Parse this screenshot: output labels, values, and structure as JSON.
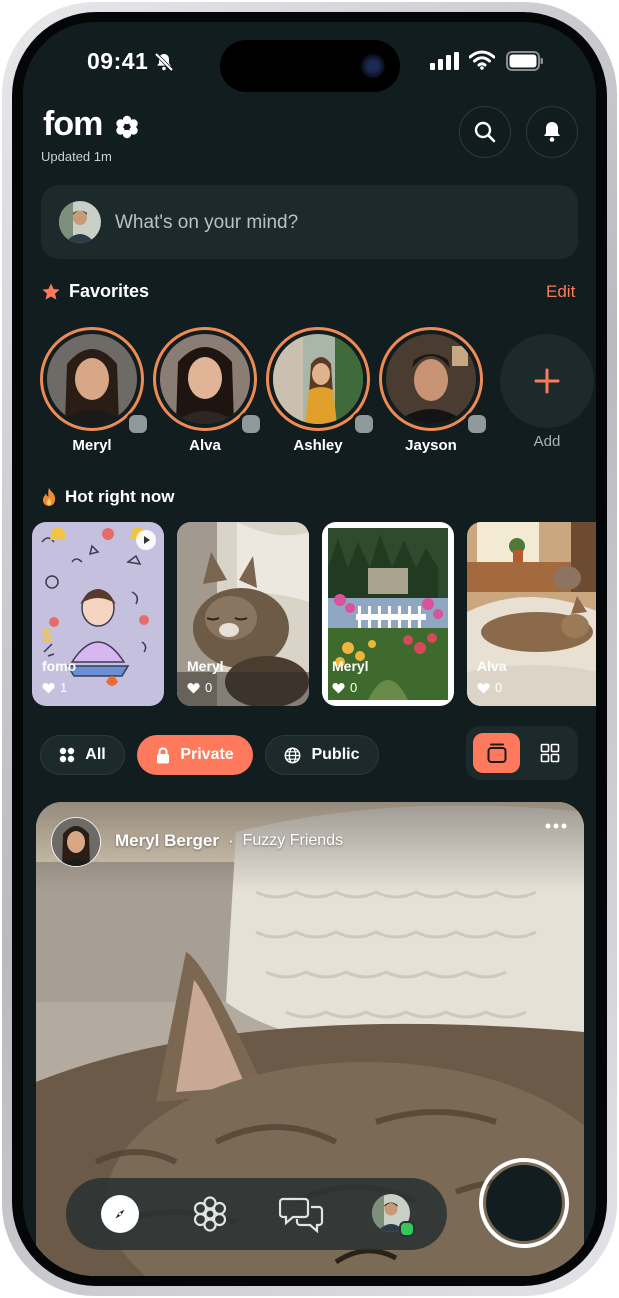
{
  "status_bar": {
    "time": "09:41"
  },
  "header": {
    "logo": "fomo",
    "updated": "Updated 1m",
    "search_icon": "search-icon",
    "bell_icon": "bell-icon"
  },
  "composer": {
    "placeholder": "What's on your mind?"
  },
  "favorites": {
    "title": "Favorites",
    "edit": "Edit",
    "people": [
      {
        "name": "Meryl"
      },
      {
        "name": "Alva"
      },
      {
        "name": "Ashley"
      },
      {
        "name": "Jayson"
      }
    ],
    "add_label": "Add"
  },
  "hot": {
    "title": "Hot right now",
    "cards": [
      {
        "name": "fomo",
        "likes": "1"
      },
      {
        "name": "Meryl",
        "likes": "0"
      },
      {
        "name": "Meryl",
        "likes": "0"
      },
      {
        "name": "Alva",
        "likes": "0"
      }
    ]
  },
  "filters": {
    "all": "All",
    "private": "Private",
    "public": "Public",
    "active": "Private"
  },
  "post": {
    "author": "Meryl Berger",
    "separator": "·",
    "group": "Fuzzy Friends"
  },
  "colors": {
    "accent": "#ff7a5c",
    "background": "#121d1f",
    "surface": "#1d2a2c",
    "ring": "#f08a55"
  }
}
